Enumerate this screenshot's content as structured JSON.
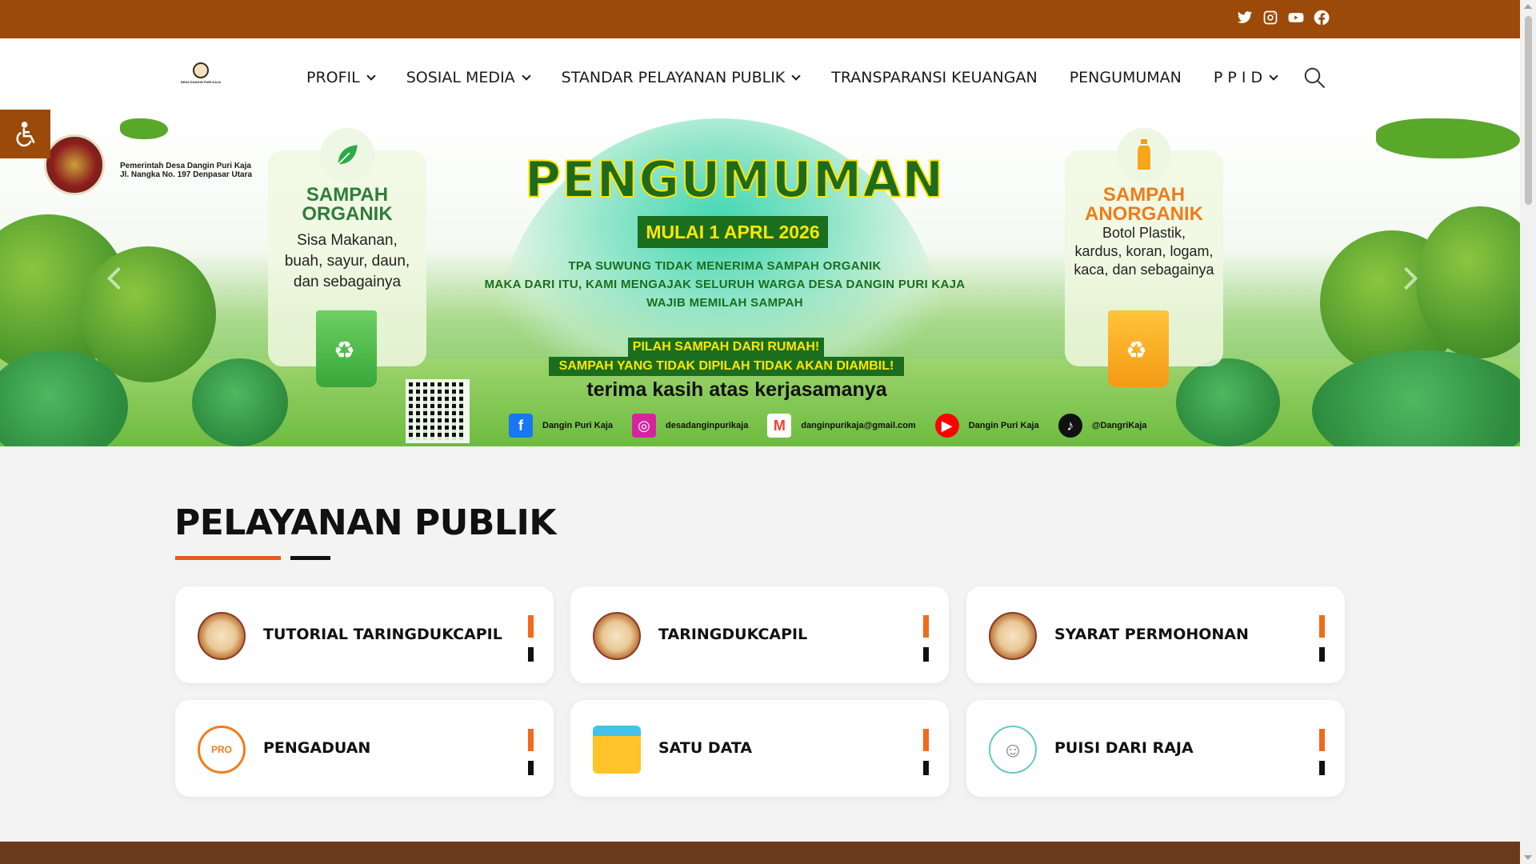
{
  "topbar": {
    "bg": "#9c4a09",
    "social_icons": [
      "twitter-icon",
      "instagram-icon",
      "youtube-icon",
      "facebook-icon"
    ]
  },
  "header": {
    "logo_text": "DESA DANGIN PURI KAJA",
    "nav": [
      {
        "label": "PROFIL",
        "dropdown": true
      },
      {
        "label": "SOSIAL MEDIA",
        "dropdown": true
      },
      {
        "label": "STANDAR PELAYANAN PUBLIK",
        "dropdown": true
      },
      {
        "label": "TRANSPARANSI KEUANGAN",
        "dropdown": false
      },
      {
        "label": "PENGUMUMAN",
        "dropdown": false
      },
      {
        "label": "P P I D",
        "dropdown": true
      }
    ],
    "search_icon": "search-icon"
  },
  "accessibility": {
    "icon": "wheelchair-icon"
  },
  "banner": {
    "org_line1": "Pemerintah Desa Dangin Puri Kaja",
    "org_line2": "Jl. Nangka No. 197 Denpasar Utara",
    "left_card": {
      "title_line1": "SAMPAH",
      "title_line2": "ORGANIK",
      "body_line1": "Sisa Makanan,",
      "body_line2": "buah, sayur, daun,",
      "body_line3": "dan sebagainya"
    },
    "right_card": {
      "title_line1": "SAMPAH",
      "title_line2": "ANORGANIK",
      "body_line1": "Botol Plastik,",
      "body_line2": "kardus, koran, logam,",
      "body_line3": "kaca, dan sebagainya"
    },
    "title": "PENGUMUMAN",
    "date": "MULAI 1 APRL 2026",
    "line1": "TPA SUWUNG TIDAK MENERIMA SAMPAH ORGANIK",
    "line2": "MAKA DARI ITU, KAMI MENGAJAK SELURUH WARGA DESA DANGIN PURI KAJA",
    "line3": "WAJIB MEMILAH SAMPAH",
    "highlight1": "PILAH SAMPAH DARI RUMAH!",
    "highlight2": "SAMPAH YANG TIDAK DIPILAH TIDAK AKAN DIAMBIL!",
    "thanks": "terima kasih atas kerjasamanya",
    "contacts": [
      {
        "icon": "facebook-icon",
        "text": "Dangin Puri Kaja",
        "color": "#1877f2"
      },
      {
        "icon": "instagram-icon",
        "text": "desadanginpurikaja",
        "color": "#d6249f"
      },
      {
        "icon": "gmail-icon",
        "text": "danginpurikaja@gmail.com",
        "color": "#ea4335"
      },
      {
        "icon": "youtube-icon",
        "text": "Dangin Puri Kaja",
        "color": "#ff0000"
      },
      {
        "icon": "tiktok-icon",
        "text": "@DangriKaja",
        "color": "#111111"
      }
    ]
  },
  "section": {
    "title": "PELAYANAN PUBLIK",
    "accent": "#e8581c",
    "tiles": [
      {
        "label": "TUTORIAL TARINGDUKCAPIL",
        "icon": "dukcapil-seal-icon"
      },
      {
        "label": "TARINGDUKCAPIL",
        "icon": "dukcapil-seal-icon"
      },
      {
        "label": "SYARAT PERMOHONAN",
        "icon": "dukcapil-seal-icon"
      },
      {
        "label": "PENGADUAN",
        "icon": "pro-denpasar-icon",
        "icon_text": "PRO"
      },
      {
        "label": "SATU DATA",
        "icon": "folder-icon"
      },
      {
        "label": "PUISI DARI RAJA",
        "icon": "children-icon"
      }
    ]
  }
}
